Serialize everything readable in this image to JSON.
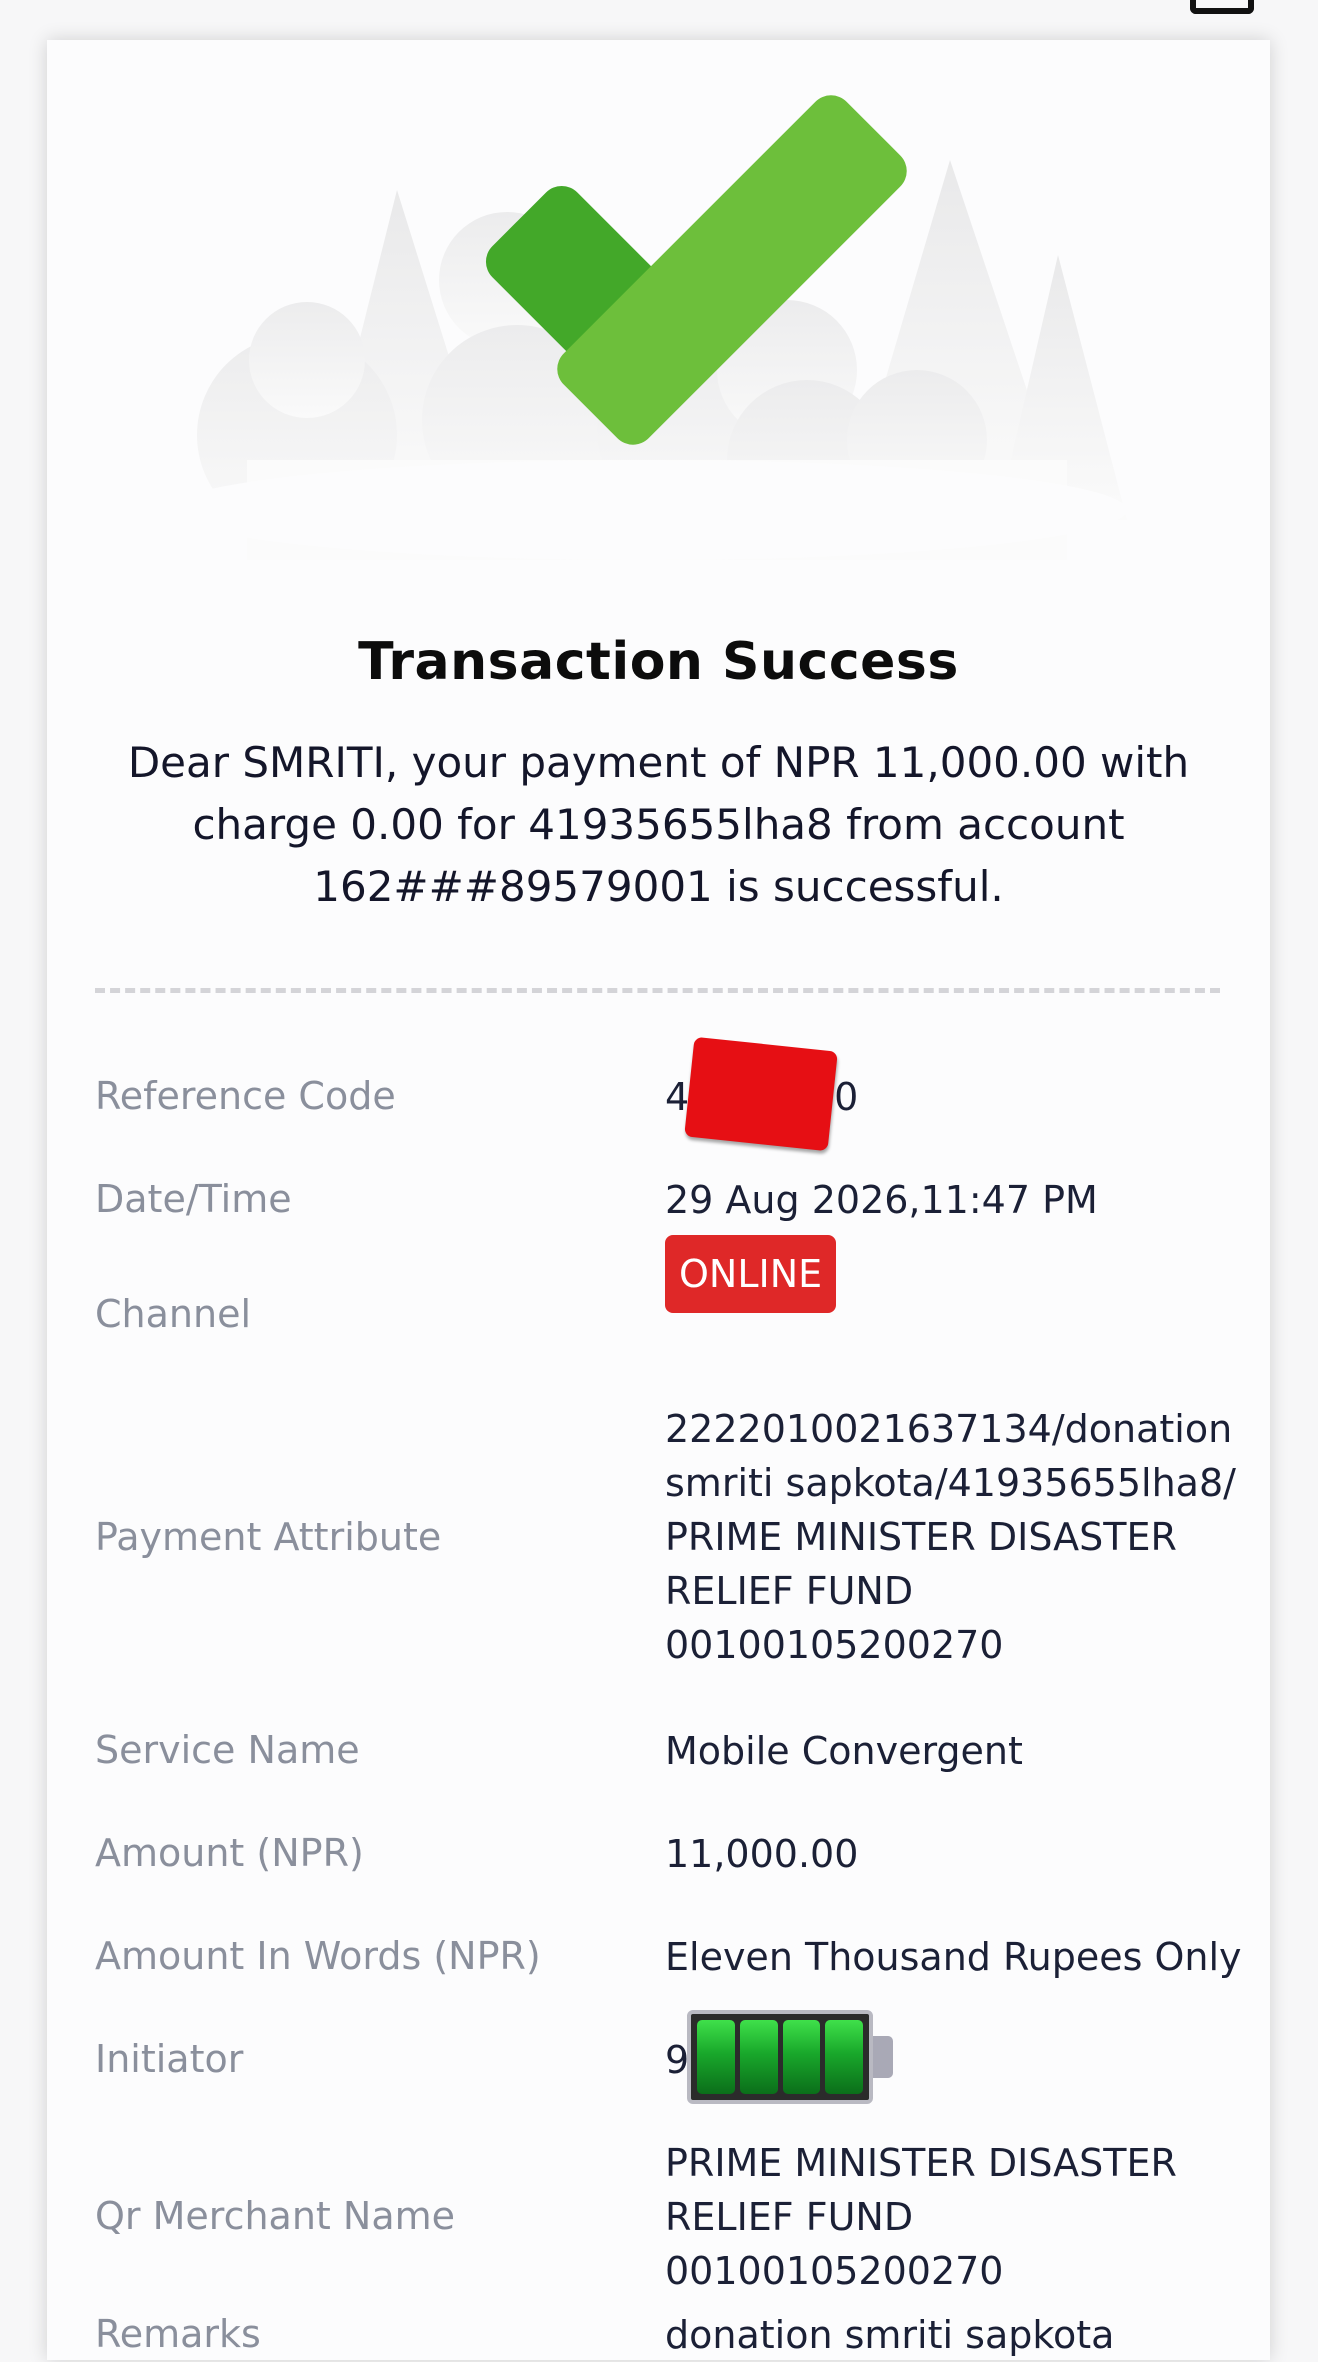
{
  "receipt": {
    "title": "Transaction Success",
    "message": "Dear SMRITI, your payment of NPR 11,000.00 with charge 0.00 for 41935655lha8 from account 162###89579001 is successful.",
    "rows": [
      {
        "label": "Reference Code",
        "value": "4          70"
      },
      {
        "label": "Date/Time",
        "value": "29 Aug 2026,11:47 PM"
      },
      {
        "label": "Channel",
        "value": "ONLINE"
      },
      {
        "label": "Payment Attribute",
        "value": "2222010021637134/donation\nsmriti sapkota/41935655lha8/\nPRIME MINISTER DISASTER\nRELIEF FUND\n00100105200270"
      },
      {
        "label": "Service Name",
        "value": "Mobile Convergent"
      },
      {
        "label": "Amount (NPR)",
        "value": "11,000.00"
      },
      {
        "label": "Amount In Words (NPR)",
        "value": "Eleven Thousand Rupees Only"
      },
      {
        "label": "Initiator",
        "value": "9"
      },
      {
        "label": "Qr Merchant Name",
        "value": "PRIME MINISTER DISASTER\nRELIEF FUND\n00100105200270"
      },
      {
        "label": "Remarks",
        "value": "donation smriti sapkota"
      }
    ]
  },
  "colors": {
    "success_green": "#6dbf3b",
    "success_green_dark": "#43a829",
    "channel_badge": "#df2828"
  },
  "icons": {
    "hero": "checkmark-icon",
    "initiator_overlay": "battery-icon"
  }
}
